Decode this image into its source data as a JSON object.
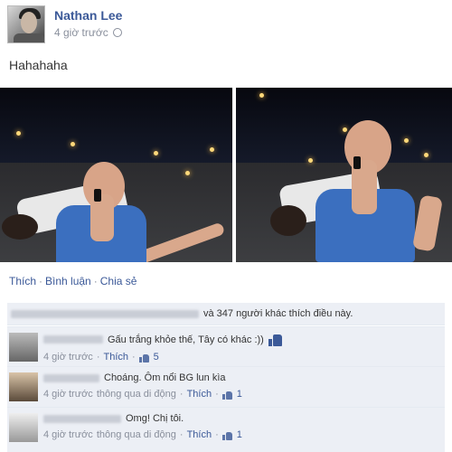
{
  "post": {
    "author": "Nathan Lee",
    "time": "4 giờ trước",
    "privacy_icon": "globe-icon",
    "text": "Hahahaha"
  },
  "actions": {
    "like": "Thích",
    "separator": "·",
    "comment": "Bình luận",
    "share": "Chia sẻ"
  },
  "likes": {
    "text": "và 347 người khác thích điều này."
  },
  "comments": [
    {
      "text": "Gấu trắng khỏe thế, Tây có khác :))",
      "time": "4 giờ trước",
      "like": "Thích",
      "separator": "·",
      "like_count": "5",
      "source": ""
    },
    {
      "text": "Choáng. Ôm nổi BG lun kìa",
      "time": "4 giờ trước",
      "source": "thông qua di động",
      "like": "Thích",
      "separator": "·",
      "like_count": "1"
    },
    {
      "text": "Omg! Chị tôi.",
      "time": "4 giờ trước",
      "source": "thông qua di động",
      "like": "Thích",
      "separator": "·",
      "like_count": "1"
    }
  ],
  "colors": {
    "link_blue": "#3b5998",
    "meta_gray": "#898f9c",
    "comment_bg": "#eceff5"
  }
}
